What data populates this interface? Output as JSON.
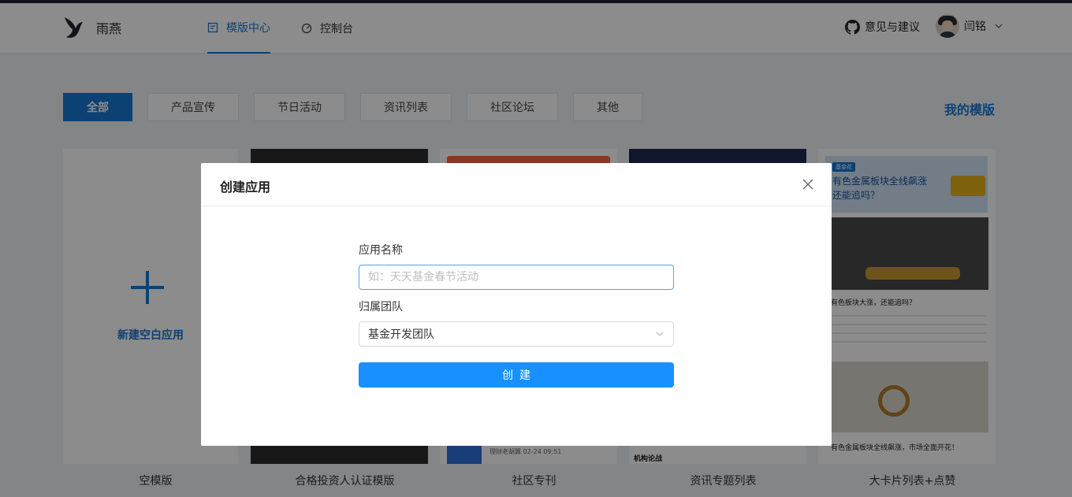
{
  "brand": {
    "name": "雨燕"
  },
  "nav": {
    "tabs": [
      {
        "label": "模版中心",
        "icon": "template-icon",
        "active": true
      },
      {
        "label": "控制台",
        "icon": "dashboard-icon",
        "active": false
      }
    ]
  },
  "header": {
    "feedback_label": "意见与建议",
    "feedback_icon": "github-icon",
    "user_name": "闫铭"
  },
  "filters": {
    "items": [
      "全部",
      "产品宣传",
      "节日活动",
      "资讯列表",
      "社区论坛",
      "其他"
    ],
    "active": "全部",
    "my_templates_label": "我的模版"
  },
  "cards": {
    "new_app_label": "新建空白应用",
    "captions": [
      "空模版",
      "合格投资人认证模版",
      "社区专刊",
      "资讯专题列表",
      "大卡片列表+点赞"
    ],
    "community_meta": "理财老胡翼 02-24 09:51",
    "news_tag": "机构论战",
    "ad_badge": "基金花",
    "ad_title": "有色金属板块全线飙涨 还能追吗？",
    "news1_title": "有色板块大涨，还能追吗？",
    "news2_title": "有色金属板块全线飙涨，市场全面开花！"
  },
  "modal": {
    "title": "创建应用",
    "name_label": "应用名称",
    "name_placeholder": "如：天天基金春节活动",
    "name_value": "",
    "team_label": "归属团队",
    "team_value": "基金开发团队",
    "submit_label": "创建"
  },
  "colors": {
    "primary": "#1677d2",
    "button": "#1890ff",
    "overlay": "rgba(0,0,0,0.45)"
  }
}
